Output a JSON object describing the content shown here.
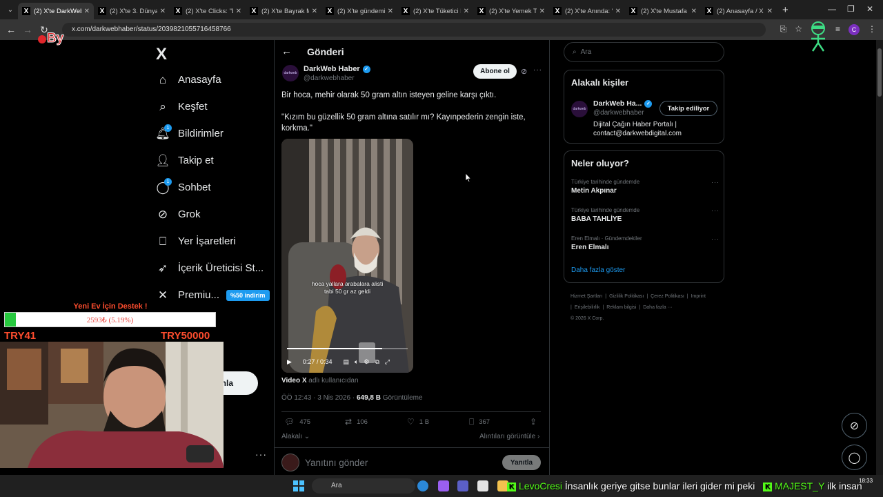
{
  "browser": {
    "tabs": [
      {
        "title": "(2) X'te DarkWeb",
        "active": true
      },
      {
        "title": "(2) X'te 3. Dünya",
        "active": false
      },
      {
        "title": "(2) X'te Clicks: \"Bi",
        "active": false
      },
      {
        "title": "(2) X'te Bayrak M",
        "active": false
      },
      {
        "title": "(2) X'te gündemi",
        "active": false
      },
      {
        "title": "(2) X'te Tüketici D",
        "active": false
      },
      {
        "title": "(2) X'te Yemek Te",
        "active": false
      },
      {
        "title": "(2) X'te Anında: \"",
        "active": false
      },
      {
        "title": "(2) X'te Mustafa",
        "active": false
      },
      {
        "title": "(2) Anasayfa / X",
        "active": false
      }
    ],
    "url": "x.com/darkwebhaber/status/2039821055716458766"
  },
  "overlay": {
    "logo_text": "By",
    "donation": {
      "title": "Yeni Ev İçin Destek !",
      "amount_text": "2593₺ (5.19%)",
      "progress_fraction": 0.0519,
      "min_label": "TRY41",
      "max_label": "TRY50000"
    }
  },
  "sidebar": {
    "logo": "X",
    "items": [
      {
        "label": "Anasayfa",
        "icon": "home-icon"
      },
      {
        "label": "Keşfet",
        "icon": "search-icon"
      },
      {
        "label": "Bildirimler",
        "icon": "bell-icon",
        "badge": "1"
      },
      {
        "label": "Takip et",
        "icon": "follow-icon"
      },
      {
        "label": "Sohbet",
        "icon": "chat-icon",
        "badge": "1"
      },
      {
        "label": "Grok",
        "icon": "grok-icon"
      },
      {
        "label": "Yer İşaretleri",
        "icon": "bookmark-icon"
      },
      {
        "label": "İçerik Üreticisi St...",
        "icon": "rocket-icon"
      },
      {
        "label": "Premiu...",
        "icon": "x-icon",
        "promo": "%50 indirim"
      }
    ],
    "post_button": "nla",
    "more": "···"
  },
  "post": {
    "header_title": "Gönderi",
    "author_name": "DarkWeb Haber",
    "author_handle": "@darkwebhaber",
    "avatar_text": "darkweb",
    "subscribe_label": "Abone ol",
    "text": "Bir hoca, mehir olarak 50 gram altın isteyen geline karşı çıktı.\n\n\"Kızım bu güzellik 50 gram altına satılır mı? Kayınpederin zengin iste, korkma.\"",
    "video": {
      "caption_line1": "hoca yallara arabalara alisti",
      "caption_line2": "tabi 50 gr az geldi",
      "time": "0:27 / 0:34",
      "progress_fraction": 0.79
    },
    "video_source_name": "Video X",
    "video_source_suffix": "adlı kullanıcıdan",
    "timestamp": "ÖÖ 12:43 · 3 Nis 2026 · ",
    "views_count": "649,8 B",
    "views_label": "Görüntüleme",
    "replies": "475",
    "reposts": "106",
    "likes": "1 B",
    "bookmarks": "367",
    "relevant_label": "Alakalı",
    "quotes_label": "Alıntıları görüntüle",
    "reply_placeholder": "Yanıtını gönder",
    "reply_button": "Yanıtla"
  },
  "right": {
    "search_placeholder": "Ara",
    "related_title": "Alakalı kişiler",
    "related_name": "DarkWeb Ha...",
    "related_handle": "@darkwebhaber",
    "follow_label": "Takip ediliyor",
    "related_bio": "Dijital Çağın Haber Portalı | contact@darkwebdigital.com",
    "trends_title": "Neler oluyor?",
    "trends": [
      {
        "context": "Türkiye tarihinde gündemde",
        "name": "Metin Akpınar"
      },
      {
        "context": "Türkiye tarihinde gündemde",
        "name": "BABA TAHLİYE"
      },
      {
        "context": "Eren Elmalı · Gündemdekiler",
        "name": "Eren Elmalı"
      }
    ],
    "show_more": "Daha fazla göster",
    "footer": [
      "Hizmet Şartları",
      "|",
      "Gizlilik Politikası",
      "|",
      "Çerez Politikası",
      "|",
      "Imprint",
      "|",
      "Erişilebilirlik",
      "|",
      "Reklam bilgisi",
      "|",
      "Daha fazla ···",
      "© 2026 X Corp."
    ]
  },
  "taskbar": {
    "search_label": "Ara",
    "ticker_user1": "LevoCresi",
    "ticker_msg1": "İnsanlık geriye gitse bunlar ileri gider mi peki",
    "ticker_user2": "MAJEST_Y",
    "ticker_msg2": "ilk insan",
    "clock": "18:33"
  }
}
